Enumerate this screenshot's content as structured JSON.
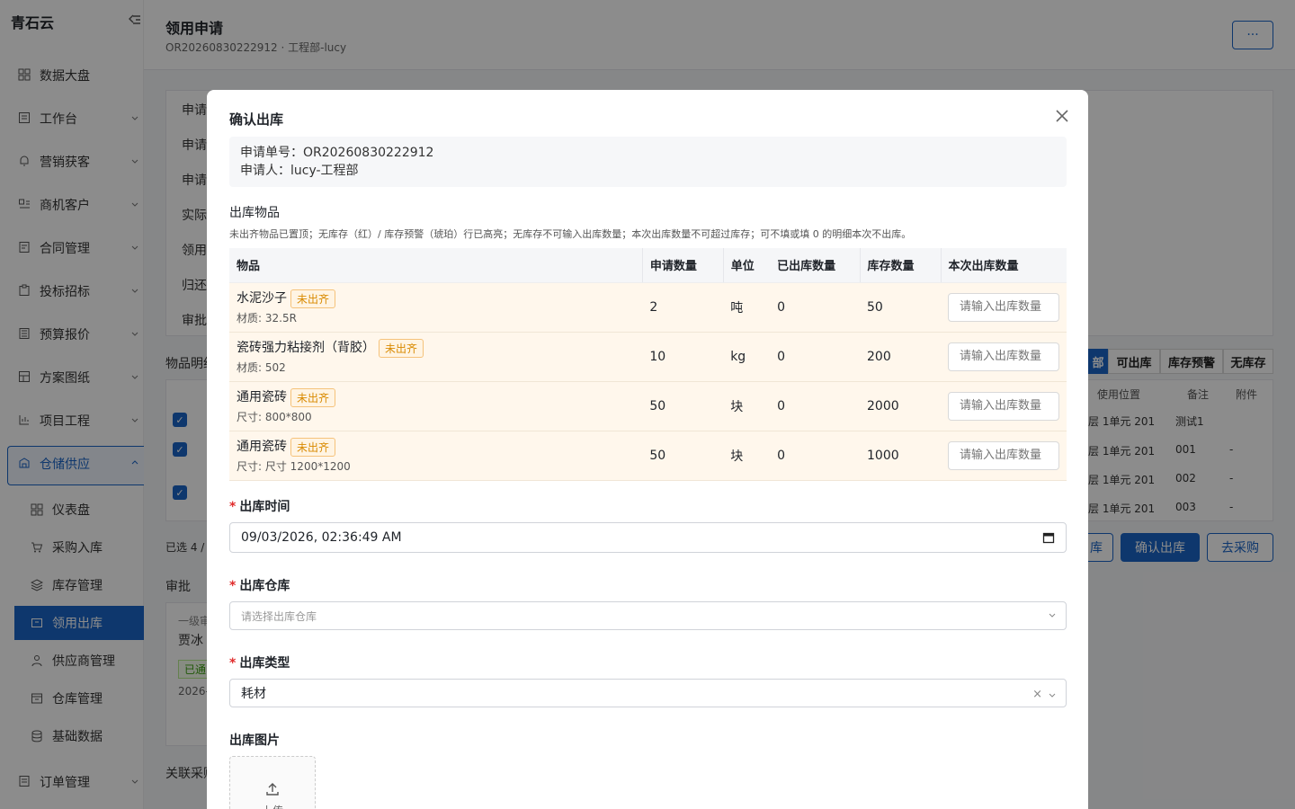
{
  "brand": "青石云",
  "sidebar": {
    "items": [
      {
        "label": "数据大盘",
        "icon": "dashboard-icon"
      },
      {
        "label": "工作台",
        "icon": "workbench-icon"
      },
      {
        "label": "营销获客",
        "icon": "marketing-icon"
      },
      {
        "label": "商机客户",
        "icon": "customer-icon"
      },
      {
        "label": "合同管理",
        "icon": "contract-icon"
      },
      {
        "label": "投标招标",
        "icon": "bidding-icon"
      },
      {
        "label": "预算报价",
        "icon": "budget-icon"
      },
      {
        "label": "方案图纸",
        "icon": "drawing-icon"
      },
      {
        "label": "项目工程",
        "icon": "project-icon"
      },
      {
        "label": "仓储供应",
        "icon": "warehouse-icon"
      },
      {
        "label": "订单管理",
        "icon": "order-icon"
      }
    ],
    "subitems": [
      {
        "label": "仪表盘",
        "icon": "dashboard-icon"
      },
      {
        "label": "采购入库",
        "icon": "cart-icon"
      },
      {
        "label": "库存管理",
        "icon": "layers-icon"
      },
      {
        "label": "领用出库",
        "icon": "outbound-icon"
      },
      {
        "label": "供应商管理",
        "icon": "supplier-icon"
      },
      {
        "label": "仓库管理",
        "icon": "warehouse-box-icon"
      },
      {
        "label": "基础数据",
        "icon": "database-icon"
      }
    ]
  },
  "header": {
    "title": "领用申请",
    "subtitle": "OR20260830222912 · 工程部-lucy",
    "more_label": "···"
  },
  "background": {
    "rows": [
      "申请",
      "申请",
      "申请",
      "实际",
      "领用",
      "归还",
      "审批"
    ],
    "items_title": "物品明细",
    "filter_tabs": [
      "部",
      "可出库",
      "库存预警",
      "无库存"
    ],
    "columns": [
      "使用位置",
      "备注",
      "附件"
    ],
    "item_rows": [
      {
        "location": "层 1单元 201",
        "note": "测试1",
        "attach": ""
      },
      {
        "location": "层 1单元 201",
        "note": "001",
        "attach": "-"
      },
      {
        "location": "层 1单元 201",
        "note": "002",
        "attach": "-"
      },
      {
        "location": "层 1单元 201",
        "note": "003",
        "attach": "-"
      }
    ],
    "selected_text": "已选 4 /",
    "btn_partial": "库",
    "btn_confirm": "确认出库",
    "btn_purchase": "去采购",
    "approval_title": "审批",
    "approval_level": "一级审",
    "approver": "贾冰",
    "approved": "已通",
    "approval_date": "2026-",
    "related": "关联采购"
  },
  "modal": {
    "title": "确认出库",
    "info": {
      "order_no": "申请单号：OR20260830222912",
      "applicant": "申请人：lucy-工程部"
    },
    "items_label": "出库物品",
    "hint": "未出齐物品已置顶；无库存（红）/ 库存预警（琥珀）行已高亮；无库存不可输入出库数量；本次出库数量不可超过库存；可不填或填 0 的明细本次不出库。",
    "table": {
      "headers": [
        "物品",
        "申请数量",
        "单位",
        "已出库数量",
        "库存数量",
        "本次出库数量"
      ],
      "rows": [
        {
          "name": "水泥沙子",
          "tag": "未出齐",
          "spec": "材质: 32.5R",
          "qty": "2",
          "unit": "吨",
          "out": "0",
          "stock": "50"
        },
        {
          "name": "瓷砖强力粘接剂（背胶）",
          "tag": "未出齐",
          "spec": "材质: 502",
          "qty": "10",
          "unit": "kg",
          "out": "0",
          "stock": "200"
        },
        {
          "name": "通用瓷砖",
          "tag": "未出齐",
          "spec": "尺寸: 800*800",
          "qty": "50",
          "unit": "块",
          "out": "0",
          "stock": "2000"
        },
        {
          "name": "通用瓷砖",
          "tag": "未出齐",
          "spec": "尺寸: 尺寸 1200*1200",
          "qty": "50",
          "unit": "块",
          "out": "0",
          "stock": "1000"
        }
      ],
      "qty_placeholder": "请输入出库数量"
    },
    "out_time_label": "出库时间",
    "out_time_value": "09/03/2026, 02:36:49 AM",
    "warehouse_label": "出库仓库",
    "warehouse_placeholder": "请选择出库仓库",
    "type_label": "出库类型",
    "type_value": "耗材",
    "image_label": "出库图片",
    "upload_label": "上传"
  }
}
